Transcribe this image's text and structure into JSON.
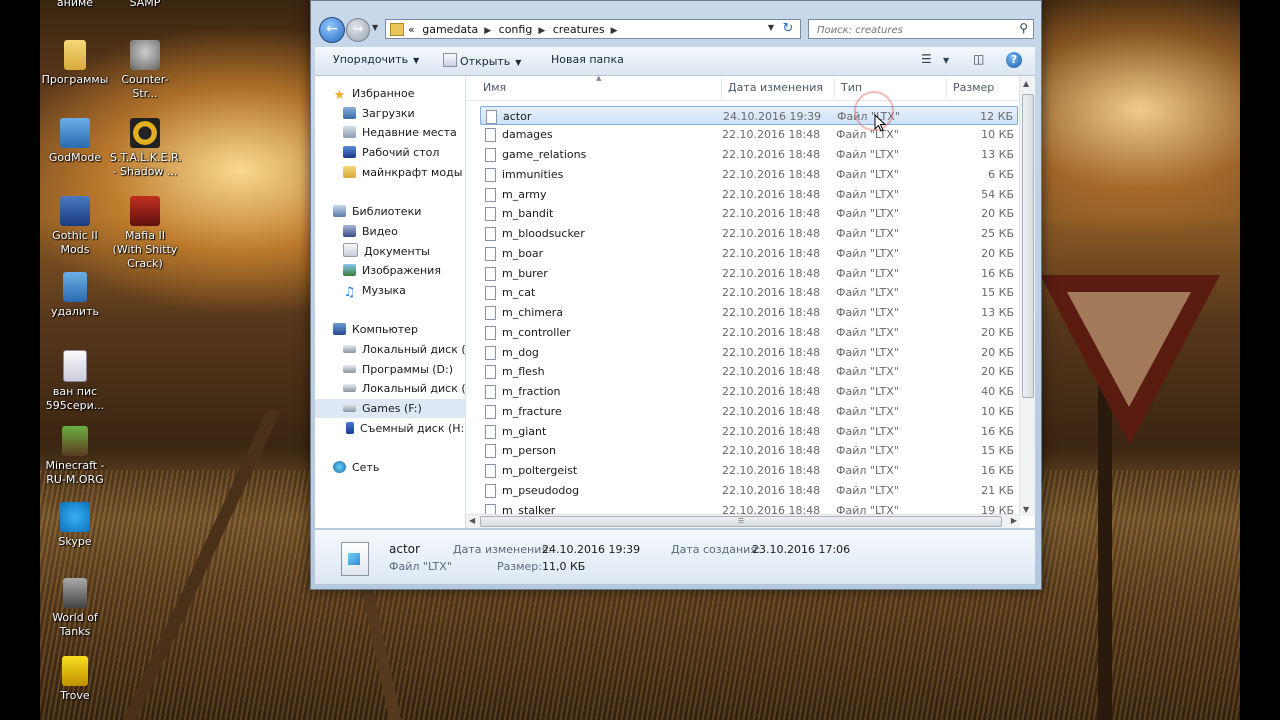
{
  "desktop": {
    "icons": [
      {
        "label": "аниме",
        "icon": "folder-icon"
      },
      {
        "label": "SAMP",
        "icon": "samp-icon"
      },
      {
        "label": "Программы",
        "icon": "folder-icon"
      },
      {
        "label": "Counter-Str...",
        "icon": "counter-strike-icon"
      },
      {
        "label": "GodMode",
        "icon": "godmode-icon"
      },
      {
        "label": "S.T.A.L.K.E.R. - Shadow ...",
        "icon": "stalker-icon"
      },
      {
        "label": "Gothic II Mods",
        "icon": "gothic-icon"
      },
      {
        "label": "Mafia II (With Shitty Crack)",
        "icon": "mafia-icon"
      },
      {
        "label": "удалить",
        "icon": "shortcut-icon"
      },
      {
        "label": "ван пис 595сери...",
        "icon": "file-icon"
      },
      {
        "label": "Minecraft - RU-M.ORG",
        "icon": "minecraft-icon"
      },
      {
        "label": "Skype",
        "icon": "skype-icon"
      },
      {
        "label": "World of Tanks",
        "icon": "wot-icon"
      },
      {
        "label": "Trove",
        "icon": "trove-icon"
      }
    ]
  },
  "address": {
    "prefix": "«",
    "crumbs": [
      "gamedata",
      "config",
      "creatures"
    ]
  },
  "search": {
    "placeholder": "Поиск: creatures"
  },
  "toolbar": {
    "organize": "Упорядочить",
    "open": "Открыть",
    "new_folder": "Новая папка"
  },
  "nav": {
    "favorites": "Избранное",
    "downloads": "Загрузки",
    "recent": "Недавние места",
    "desktop": "Рабочий стол",
    "minecraft_mods": "майнкрафт моды",
    "libraries": "Библиотеки",
    "video": "Видео",
    "documents": "Документы",
    "images": "Изображения",
    "music": "Музыка",
    "computer": "Компьютер",
    "drive_c": "Локальный диск (C",
    "drive_d": "Программы (D:)",
    "drive_e": "Локальный диск (E:",
    "drive_f": "Games (F:)",
    "drive_h": "Съемный диск (H:)",
    "network": "Сеть"
  },
  "columns": {
    "name": "Имя",
    "date": "Дата изменения",
    "type": "Тип",
    "size": "Размер"
  },
  "files": [
    {
      "name": "actor",
      "date": "24.10.2016 19:39",
      "type": "Файл \"LTX\"",
      "size": "12 КБ"
    },
    {
      "name": "damages",
      "date": "22.10.2016 18:48",
      "type": "Файл \"LTX\"",
      "size": "10 КБ"
    },
    {
      "name": "game_relations",
      "date": "22.10.2016 18:48",
      "type": "Файл \"LTX\"",
      "size": "13 КБ"
    },
    {
      "name": "immunities",
      "date": "22.10.2016 18:48",
      "type": "Файл \"LTX\"",
      "size": "6 КБ"
    },
    {
      "name": "m_army",
      "date": "22.10.2016 18:48",
      "type": "Файл \"LTX\"",
      "size": "54 КБ"
    },
    {
      "name": "m_bandit",
      "date": "22.10.2016 18:48",
      "type": "Файл \"LTX\"",
      "size": "20 КБ"
    },
    {
      "name": "m_bloodsucker",
      "date": "22.10.2016 18:48",
      "type": "Файл \"LTX\"",
      "size": "25 КБ"
    },
    {
      "name": "m_boar",
      "date": "22.10.2016 18:48",
      "type": "Файл \"LTX\"",
      "size": "20 КБ"
    },
    {
      "name": "m_burer",
      "date": "22.10.2016 18:48",
      "type": "Файл \"LTX\"",
      "size": "16 КБ"
    },
    {
      "name": "m_cat",
      "date": "22.10.2016 18:48",
      "type": "Файл \"LTX\"",
      "size": "15 КБ"
    },
    {
      "name": "m_chimera",
      "date": "22.10.2016 18:48",
      "type": "Файл \"LTX\"",
      "size": "13 КБ"
    },
    {
      "name": "m_controller",
      "date": "22.10.2016 18:48",
      "type": "Файл \"LTX\"",
      "size": "20 КБ"
    },
    {
      "name": "m_dog",
      "date": "22.10.2016 18:48",
      "type": "Файл \"LTX\"",
      "size": "20 КБ"
    },
    {
      "name": "m_flesh",
      "date": "22.10.2016 18:48",
      "type": "Файл \"LTX\"",
      "size": "20 КБ"
    },
    {
      "name": "m_fraction",
      "date": "22.10.2016 18:48",
      "type": "Файл \"LTX\"",
      "size": "40 КБ"
    },
    {
      "name": "m_fracture",
      "date": "22.10.2016 18:48",
      "type": "Файл \"LTX\"",
      "size": "10 КБ"
    },
    {
      "name": "m_giant",
      "date": "22.10.2016 18:48",
      "type": "Файл \"LTX\"",
      "size": "16 КБ"
    },
    {
      "name": "m_person",
      "date": "22.10.2016 18:48",
      "type": "Файл \"LTX\"",
      "size": "15 КБ"
    },
    {
      "name": "m_poltergeist",
      "date": "22.10.2016 18:48",
      "type": "Файл \"LTX\"",
      "size": "16 КБ"
    },
    {
      "name": "m_pseudodog",
      "date": "22.10.2016 18:48",
      "type": "Файл \"LTX\"",
      "size": "21 КБ"
    },
    {
      "name": "m_stalker",
      "date": "22.10.2016 18:48",
      "type": "Файл \"LTX\"",
      "size": "19 КБ"
    }
  ],
  "details": {
    "name": "actor",
    "type": "Файл \"LTX\"",
    "modified_label": "Дата изменения:",
    "modified": "24.10.2016 19:39",
    "created_label": "Дата создания:",
    "created": "23.10.2016 17:06",
    "size_label": "Размер:",
    "size": "11,0 КБ"
  }
}
